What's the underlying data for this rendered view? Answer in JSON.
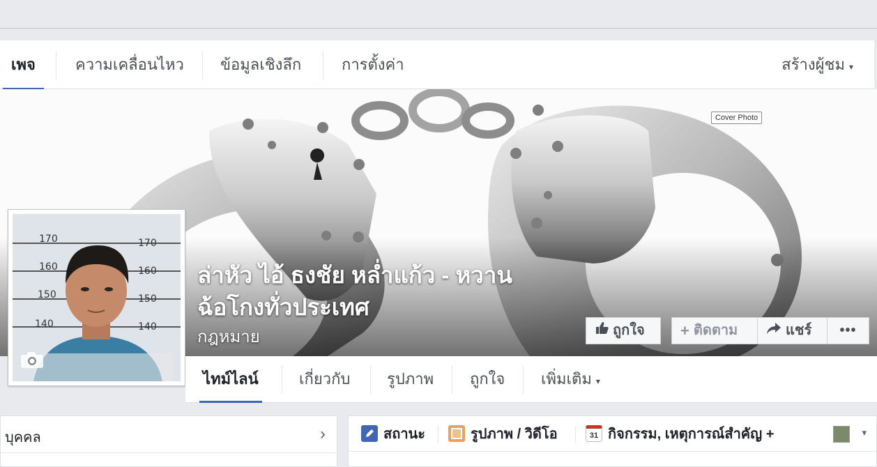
{
  "admin_tabs": [
    {
      "label": "เพจ",
      "active": true
    },
    {
      "label": "ความเคลื่อนไหว",
      "active": false
    },
    {
      "label": "ข้อมูลเชิงลึก",
      "active": false
    },
    {
      "label": "การตั้งค่า",
      "active": false
    }
  ],
  "build_audience": {
    "label": "สร้างผู้ชม",
    "caret": "▾"
  },
  "cover": {
    "label": "Cover Photo"
  },
  "page": {
    "name": "ล่าหัว ไอ้ ธงชัย หล่ำแก้ว - หวานฉ้อโกงทั่วประเทศ",
    "category": "กฎหมาย"
  },
  "actions": {
    "like": "ถูกใจ",
    "follow": "ติดตาม",
    "share": "แชร์",
    "more": "•••"
  },
  "profile_tabs": [
    {
      "label": "ไทม์ไลน์",
      "active": true
    },
    {
      "label": "เกี่ยวกับ",
      "active": false
    },
    {
      "label": "รูปภาพ",
      "active": false
    },
    {
      "label": "ถูกใจ",
      "active": false
    },
    {
      "label": "เพิ่มเติม",
      "active": false,
      "caret": "▾"
    }
  ],
  "left_box": {
    "title": "บุคคล",
    "chevron": "›"
  },
  "composer": {
    "status": "สถานะ",
    "photo_video": "รูปภาพ / วิดีโอ",
    "event": "กิจกรรม, เหตุการณ์สำคัญ +",
    "calendar_day": "31"
  },
  "mugshot_marks": [
    "170",
    "160",
    "150",
    "140"
  ],
  "colors": {
    "accent": "#4267b2",
    "page_bg": "#e9eaed"
  }
}
